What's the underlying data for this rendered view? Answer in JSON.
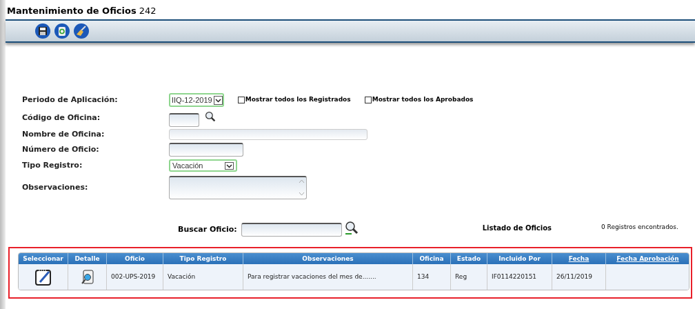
{
  "window": {
    "title": "Mantenimiento de Oficios",
    "number": "242"
  },
  "form": {
    "periodo": {
      "label": "Periodo de Aplicación:",
      "value": "IIQ-12-2019"
    },
    "checkboxes": [
      {
        "label": "Mostrar todos los Registrados",
        "checked": false
      },
      {
        "label": "Mostrar todos los Aprobados",
        "checked": false
      }
    ],
    "codigo": {
      "label": "Código de Oficina:"
    },
    "nombre": {
      "label": "Nombre de Oficina:"
    },
    "numero": {
      "label": "Número de Oficio:"
    },
    "tipo": {
      "label": "Tipo Registro:",
      "value": "Vacación"
    },
    "observaciones": {
      "label": "Observaciones:"
    }
  },
  "search": {
    "label": "Buscar Oficio:",
    "list_title": "Listado de Oficios",
    "count": "0 Registros encontrados."
  },
  "table": {
    "columns": [
      {
        "label": "Seleccionar",
        "sortable": false
      },
      {
        "label": "Detalle",
        "sortable": false
      },
      {
        "label": "Oficio",
        "sortable": false
      },
      {
        "label": "Tipo Registro",
        "sortable": false
      },
      {
        "label": "Observaciones",
        "sortable": false
      },
      {
        "label": "Oficina",
        "sortable": false
      },
      {
        "label": "Estado",
        "sortable": false
      },
      {
        "label": "Incluido Por",
        "sortable": false
      },
      {
        "label": "Fecha",
        "sortable": true
      },
      {
        "label": "Fecha Aprobación",
        "sortable": true
      }
    ],
    "rows": [
      {
        "oficio": "002-UPS-2019",
        "tipo": "Vacación",
        "observaciones": "Para registrar vacaciones del mes de.......",
        "oficina": "134",
        "estado": "Reg",
        "incluido_por": "IF0114220151",
        "fecha": "26/11/2019"
      }
    ]
  }
}
